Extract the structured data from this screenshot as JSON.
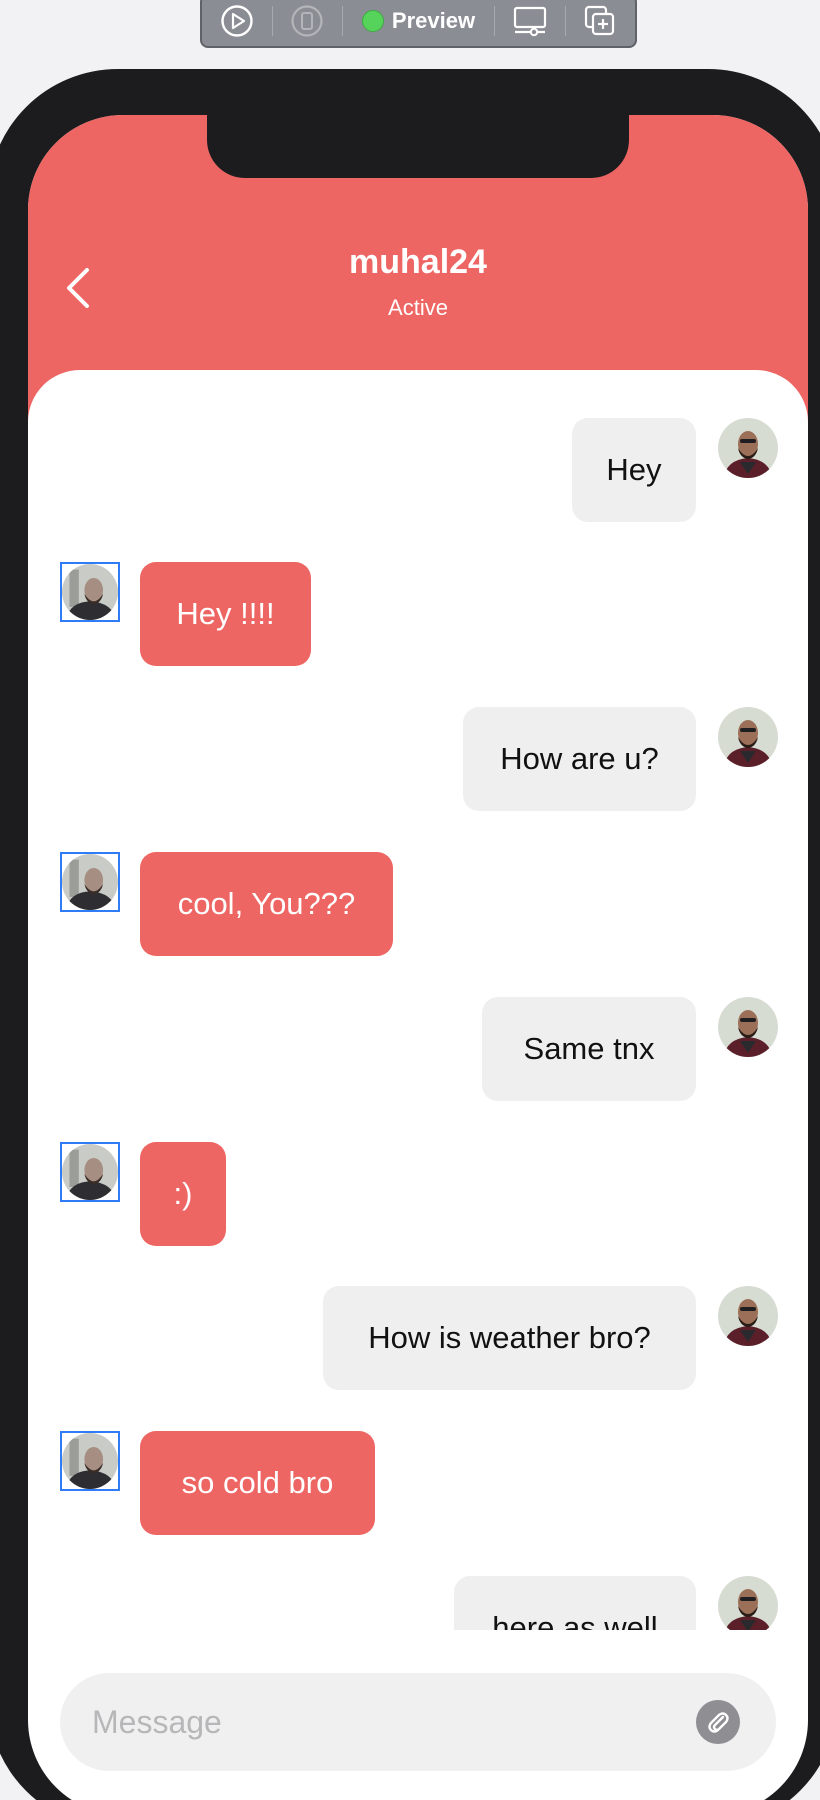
{
  "toolbar": {
    "preview_label": "Preview",
    "icons": [
      "play-circle-icon",
      "device-icon",
      "status-dot-icon",
      "display-settings-icon",
      "duplicate-icon"
    ]
  },
  "chat": {
    "contact_name": "muhal24",
    "status": "Active"
  },
  "messages": [
    {
      "text": "Hey",
      "from": "me"
    },
    {
      "text": "Hey !!!!",
      "from": "them"
    },
    {
      "text": "How are u?",
      "from": "me"
    },
    {
      "text": "cool, You???",
      "from": "them"
    },
    {
      "text": "Same tnx",
      "from": "me"
    },
    {
      "text": ":)",
      "from": "them"
    },
    {
      "text": "How is weather bro?",
      "from": "me"
    },
    {
      "text": "so cold bro",
      "from": "them"
    },
    {
      "text": "here as well",
      "from": "me"
    }
  ],
  "composer": {
    "placeholder": "Message",
    "value": ""
  },
  "colors": {
    "accent": "#ee6663",
    "sent_bubble": "#efefef",
    "frame": "#1c1c1e",
    "placeholder": "#b7b7b9"
  }
}
